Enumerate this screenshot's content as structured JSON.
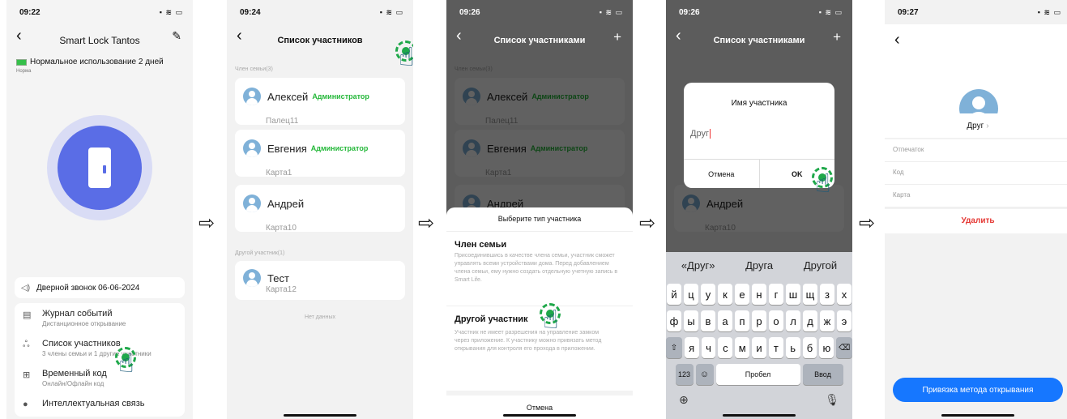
{
  "arrow_glyph": "⇨",
  "status_icons": "▪ ≋ ▭",
  "screen1": {
    "time": "09:22",
    "title": "Smart Lock Tantos",
    "battery_text": "Нормальное использование 2 дней",
    "battery_sub": "Норма",
    "doorbell": "Дверной звонок 06-06-2024",
    "menu": [
      {
        "icon": "event-log-icon",
        "title": "Журнал событий",
        "sub": "Дистанционное открывание"
      },
      {
        "icon": "members-icon",
        "title": "Список участников",
        "sub": "3 члены семьи и 1 другие участники"
      },
      {
        "icon": "temp-code-icon",
        "title": "Временный код",
        "sub": "Онлайн/Офлайн код"
      },
      {
        "icon": "smart-link-icon",
        "title": "Интеллектуальная связь",
        "sub": ""
      }
    ]
  },
  "screen2": {
    "time": "09:24",
    "title": "Список участников",
    "family_section": "Член семьи(3)",
    "members": [
      {
        "name": "Алексей",
        "role": "Администратор",
        "sub": "Палец11"
      },
      {
        "name": "Евгения",
        "role": "Администратор",
        "sub": "Карта1"
      },
      {
        "name": "Андрей",
        "role": "",
        "sub": "Карта10"
      }
    ],
    "other_section": "Другой участник(1)",
    "other_member": {
      "name": "Тест",
      "sub": "Карта12"
    },
    "no_data": "Нет данных"
  },
  "screen3": {
    "time": "09:26",
    "title": "Список участниками",
    "sheet_title": "Выберите тип участника",
    "family_title": "Член семьи",
    "family_desc": "Присоединившись в качестве члена семьи, участник сможет управлять всеми устройствами дома. Перед добавлением члена семьи, ему нужно создать отдельную учетную запись в Smart Life.",
    "other_title": "Другой участник",
    "other_desc": "Участник не имеет разрешения на управление замком через приложение. К участнику можно привязать метод открывания для контроля его прохода в приложении.",
    "cancel": "Отмена"
  },
  "screen4": {
    "time": "09:26",
    "title": "Список участниками",
    "dialog_title": "Имя участника",
    "input_value": "Друг",
    "cancel": "Отмена",
    "ok": "OK",
    "suggestions": [
      "«Друг»",
      "Друга",
      "Другой"
    ],
    "row1": [
      "й",
      "ц",
      "у",
      "к",
      "е",
      "н",
      "г",
      "ш",
      "щ",
      "з",
      "х"
    ],
    "row2": [
      "ф",
      "ы",
      "в",
      "а",
      "п",
      "р",
      "о",
      "л",
      "д",
      "ж",
      "э"
    ],
    "row3": [
      "я",
      "ч",
      "с",
      "м",
      "и",
      "т",
      "ь",
      "б",
      "ю"
    ],
    "key_123": "123",
    "key_space": "Пробел",
    "key_enter": "Ввод"
  },
  "screen5": {
    "time": "09:27",
    "name": "Друг",
    "items": [
      "Отпечаток",
      "Код",
      "Карта"
    ],
    "delete": "Удалить",
    "bind_button": "Привязка метода открывания"
  }
}
